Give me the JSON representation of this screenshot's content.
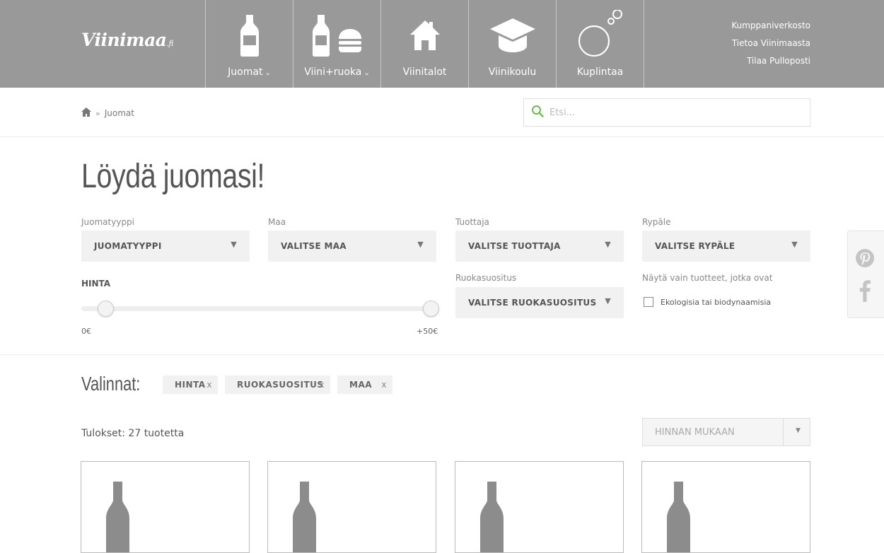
{
  "logo": {
    "text": "Viinimaa",
    "suffix": ".fi"
  },
  "nav": [
    {
      "label": "Juomat",
      "icon": "bottle-icon",
      "has_dropdown": true
    },
    {
      "label": "Viini+ruoka",
      "icon": "bottle-burger-icon",
      "has_dropdown": true
    },
    {
      "label": "Viinitalot",
      "icon": "house-icon",
      "has_dropdown": false
    },
    {
      "label": "Viinikoulu",
      "icon": "graduation-cap-icon",
      "has_dropdown": false
    },
    {
      "label": "Kuplintaa",
      "icon": "bubbles-icon",
      "has_dropdown": false
    }
  ],
  "utility_links": [
    "Kumppaniverkosto",
    "Tietoa Viinimaasta",
    "Tilaa Pulloposti"
  ],
  "breadcrumb": {
    "separator": "»",
    "current": "Juomat"
  },
  "search": {
    "placeholder": "Etsi..."
  },
  "page_title": "Löydä juomasi!",
  "filters": {
    "juomatyyppi": {
      "label": "Juomatyyppi",
      "value": "JUOMATYYPPI"
    },
    "maa": {
      "label": "Maa",
      "value": "VALITSE MAA"
    },
    "tuottaja": {
      "label": "Tuottaja",
      "value": "VALITSE TUOTTAJA"
    },
    "rypale": {
      "label": "Rypäle",
      "value": "VALITSE RYPÄLE"
    },
    "ruokasuositus": {
      "label": "Ruokasuositus",
      "value": "VALITSE RUOKASUOSITUS"
    },
    "nayta": {
      "label": "Näytä vain tuotteet, jotka ovat",
      "checkbox_label": "Ekologisia tai biodynaamisia",
      "checked": false
    }
  },
  "price": {
    "label": "HINTA",
    "min_label": "0€",
    "max_label": "+50€",
    "range_start": 0,
    "range_end": 1
  },
  "selections": {
    "label": "Valinnat:",
    "chips": [
      "HINTA",
      "RUOKASUOSITUS",
      "MAA"
    ],
    "remove_glyph": "x"
  },
  "results": {
    "text": "Tulokset: 27 tuotetta"
  },
  "sort": {
    "value": "HINNAN MUKAAN"
  },
  "colors": {
    "header_bg": "#999999",
    "accent_search": "#6cc04a",
    "chip_bg": "#f1f1f1"
  }
}
